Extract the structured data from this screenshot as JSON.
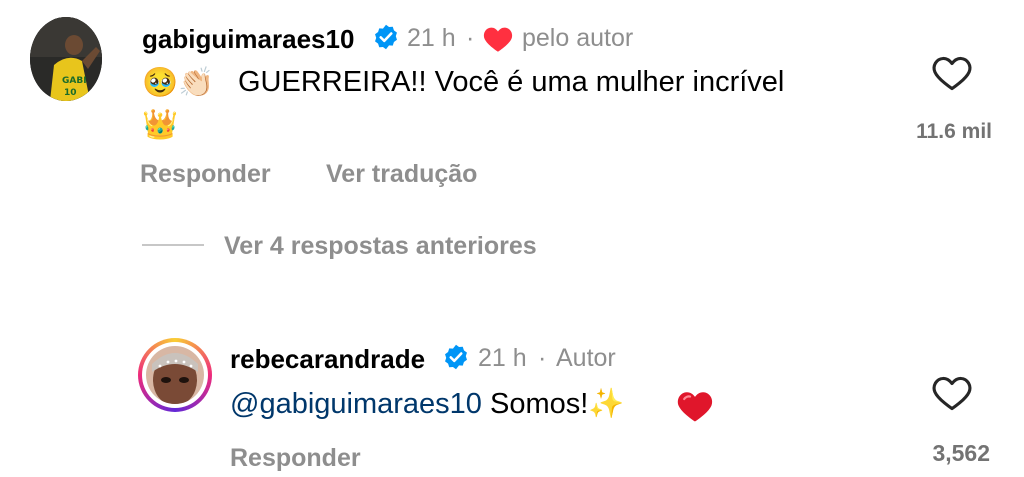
{
  "comment1": {
    "username": "gabiguimaraes10",
    "time": "21 h",
    "separator": "·",
    "liked_by_author_label": "pelo autor",
    "text_line1": "GUERREIRA!! Você é uma mulher incrível",
    "emoji_prefix": "🥹👏🏻",
    "emoji_line2": "👑",
    "like_count": "11.6 mil",
    "reply_label": "Responder",
    "translate_label": "Ver tradução"
  },
  "replies_toggle": {
    "label": "Ver 4 respostas anteriores"
  },
  "comment2": {
    "username": "rebecarandrade",
    "time": "21 h",
    "separator": "·",
    "author_label": "Autor",
    "mention": "@gabiguimaraes10",
    "text": "Somos!",
    "emoji_suffix": "✨",
    "like_count": "3,562",
    "reply_label": "Responder"
  },
  "colors": {
    "verified_blue": "#0095f6",
    "heart_red": "#ff3040",
    "muted_text": "#8e8e8e",
    "mention_blue": "#00376b"
  },
  "icons": {
    "verified": "verified-badge-icon",
    "author_heart": "heart-filled-icon",
    "like": "heart-outline-icon",
    "red_heart_emoji": "red-heart-emoji-icon"
  }
}
